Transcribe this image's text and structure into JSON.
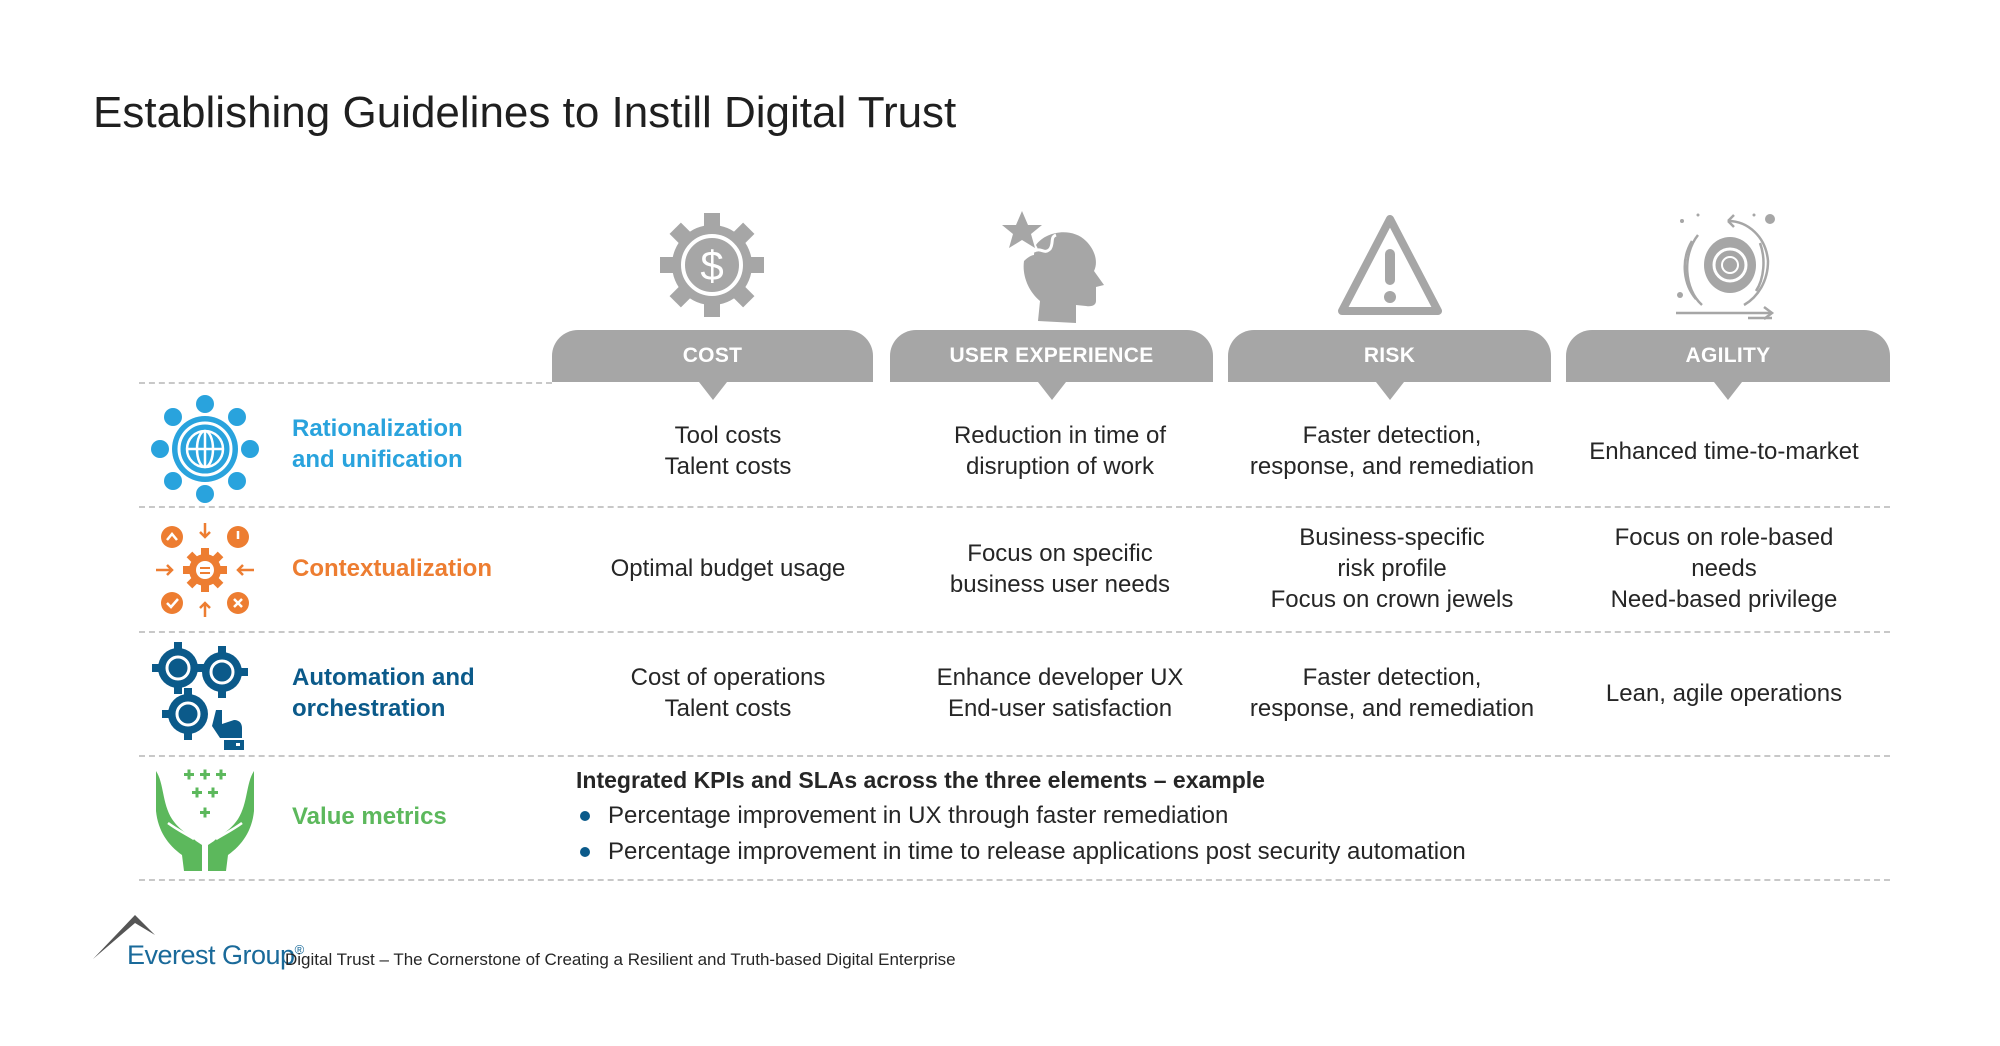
{
  "title": "Establishing Guidelines to Instill Digital Trust",
  "columns": [
    {
      "label": "COST",
      "icon": "dollar-gear-icon"
    },
    {
      "label": "USER EXPERIENCE",
      "icon": "head-star-icon"
    },
    {
      "label": "RISK",
      "icon": "warning-triangle-icon"
    },
    {
      "label": "AGILITY",
      "icon": "agile-gear-cycle-icon"
    }
  ],
  "rows": [
    {
      "label": "Rationalization and unification",
      "label_lines": [
        "Rationalization",
        "and unification"
      ],
      "color": "#29a3dd",
      "icon": "globe-network-icon",
      "cells": [
        [
          "Tool costs",
          "Talent costs"
        ],
        [
          "Reduction in time of",
          "disruption of work"
        ],
        [
          "Faster detection,",
          "response, and remediation"
        ],
        [
          "Enhanced time-to-market"
        ]
      ]
    },
    {
      "label": "Contextualization",
      "label_lines": [
        "Contextualization"
      ],
      "color": "#ed7d31",
      "icon": "context-gear-icon",
      "cells": [
        [
          "Optimal budget usage"
        ],
        [
          "Focus on specific",
          "business user needs"
        ],
        [
          "Business-specific",
          "risk profile",
          "Focus on crown jewels"
        ],
        [
          "Focus on role-based",
          "needs",
          "Need-based privilege"
        ]
      ]
    },
    {
      "label": "Automation and orchestration",
      "label_lines": [
        "Automation and",
        "orchestration"
      ],
      "color": "#0b5a8a",
      "icon": "gears-hand-icon",
      "cells": [
        [
          "Cost of operations",
          "Talent costs"
        ],
        [
          "Enhance developer UX",
          "End-user satisfaction"
        ],
        [
          "Faster detection,",
          "response, and remediation"
        ],
        [
          "Lean, agile operations"
        ]
      ]
    },
    {
      "label": "Value metrics",
      "label_lines": [
        "Value metrics"
      ],
      "color": "#5cb85c",
      "icon": "hands-plus-icon"
    }
  ],
  "value_metrics": {
    "heading": "Integrated KPIs and SLAs across the three elements – example",
    "bullets": [
      "Percentage improvement in UX through faster remediation",
      "Percentage improvement in time to release applications post security automation"
    ]
  },
  "colors": {
    "header_gray": "#a6a6a6",
    "bullet_blue": "#0b5a8a",
    "brand_blue": "#1a6a9a"
  },
  "footer": {
    "brand": "Everest Group",
    "registered": "®",
    "caption": "Digital Trust – The Cornerstone of Creating a Resilient and Truth-based Digital Enterprise"
  }
}
